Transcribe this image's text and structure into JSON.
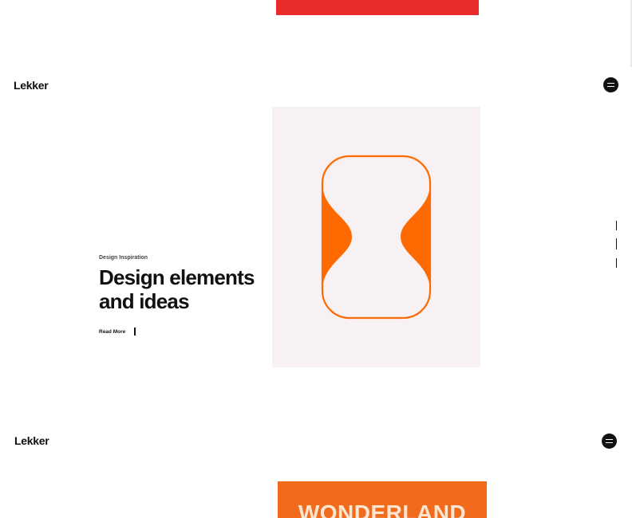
{
  "brand": {
    "logo_text": "Lekker"
  },
  "colors": {
    "red_card": "#e82c2c",
    "orange_accent": "#ff6a00",
    "pink_card": "#f8f1f4",
    "orange_card": "#f26a1b"
  },
  "hero": {
    "eyebrow": "Design Inspiration",
    "headline_line1": "Design elements",
    "headline_line2": "and ideas",
    "read_more": "Read More"
  },
  "next_card": {
    "title": "WONDERLAND"
  },
  "icons": {
    "menu": "menu-lines-icon",
    "shape": "hourglass-shape-icon"
  }
}
